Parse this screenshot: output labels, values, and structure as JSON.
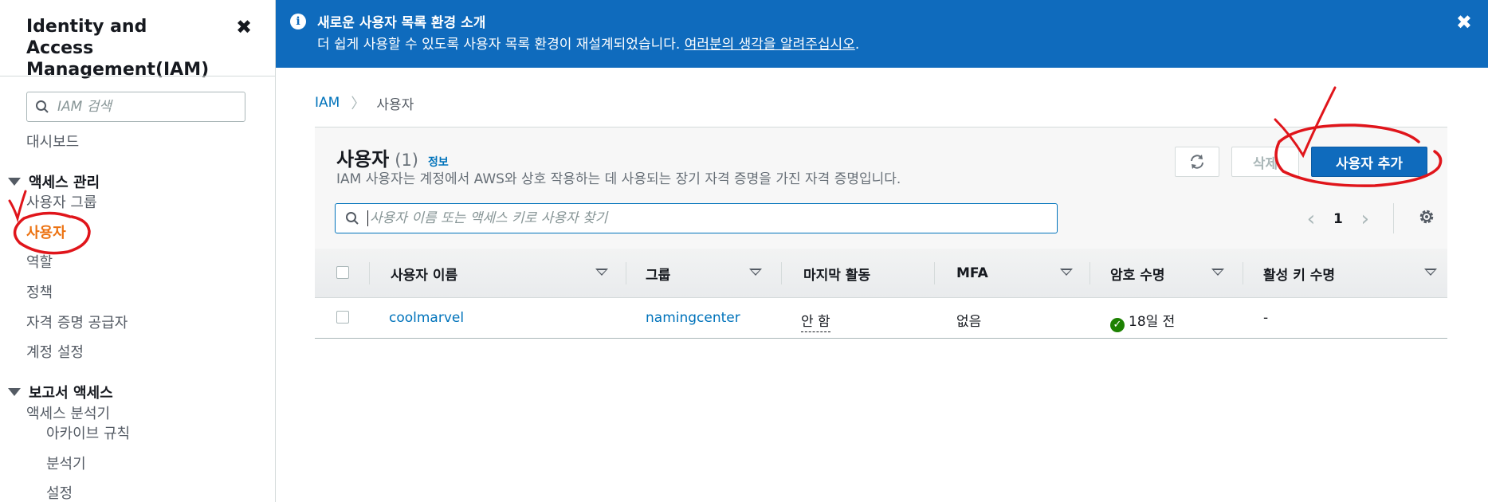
{
  "sidebar": {
    "title": "Identity and Access Management(IAM)",
    "search_placeholder": "IAM 검색",
    "dashboard": "대시보드",
    "access_mgmt": {
      "label": "액세스 관리",
      "items": [
        "사용자 그룹",
        "사용자",
        "역할",
        "정책",
        "자격 증명 공급자",
        "계정 설정"
      ]
    },
    "reports": {
      "label": "보고서 액세스",
      "analyzer": "액세스 분석기",
      "sub_items": [
        "아카이브 규칙",
        "분석기",
        "설정"
      ]
    }
  },
  "banner": {
    "title": "새로운 사용자 목록 환경 소개",
    "text": "더 쉽게 사용할 수 있도록 사용자 목록 환경이 재설계되었습니다. ",
    "link": "여러분의 생각을 알려주십시오",
    "suffix": "."
  },
  "breadcrumb": {
    "root": "IAM",
    "current": "사용자"
  },
  "panel": {
    "title": "사용자",
    "count": "(1)",
    "info": "정보",
    "description": "IAM 사용자는 계정에서 AWS와 상호 작용하는 데 사용되는 장기 자격 증명을 가진 자격 증명입니다.",
    "delete_label": "삭제",
    "add_label": "사용자 추가",
    "search_placeholder": "사용자 이름 또는 액세스 키로 사용자 찾기",
    "page": "1"
  },
  "table": {
    "columns": [
      "사용자 이름",
      "그룹",
      "마지막 활동",
      "MFA",
      "암호 수명",
      "활성 키 수명"
    ],
    "rows": [
      {
        "user": "coolmarvel",
        "group": "namingcenter",
        "last_activity": "안 함",
        "mfa": "없음",
        "password_age": "18일 전",
        "key_age": "-"
      }
    ]
  },
  "colors": {
    "accent": "#0f6bbd",
    "active_nav": "#ec7211",
    "annotation": "#e0151b",
    "success": "#1d8102"
  },
  "icons": [
    "search-icon",
    "close-icon",
    "info-icon",
    "refresh-icon",
    "gear-icon",
    "chevron-left-icon",
    "chevron-right-icon",
    "check-circle-icon"
  ]
}
